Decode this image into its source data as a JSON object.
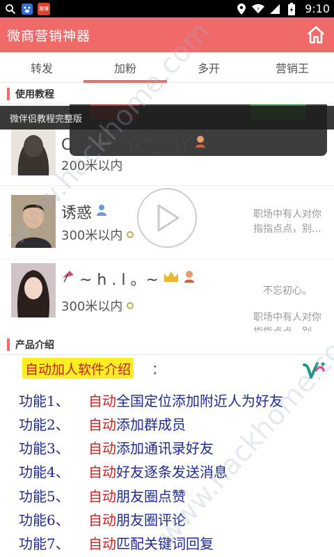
{
  "status_bar": {
    "time": "9:10",
    "app_badge": "赛博",
    "icons": [
      "search-icon",
      "baidu-icon",
      "app-badge-icon",
      "location-icon",
      "wifi-icon",
      "signal-icon",
      "battery-icon"
    ]
  },
  "app_bar": {
    "title": "微商营销神器",
    "home_icon": "home-icon"
  },
  "tabs": [
    {
      "label": "转发",
      "active": false
    },
    {
      "label": "加粉",
      "active": true
    },
    {
      "label": "多开",
      "active": false
    },
    {
      "label": "营销王",
      "active": false
    }
  ],
  "tutorial": {
    "section_label": "使用教程",
    "overlay_title": "微伴侣教程完整版",
    "contacts": [
      {
        "name": "C - - M　Y(^_^)Y",
        "distance": "200米以内",
        "message": ""
      },
      {
        "name": "诱惑",
        "distance": "300米以内",
        "message": "职场中有人对你指指点点，别..."
      },
      {
        "name": "~ h . l 。~",
        "distance": "300米以内",
        "message": "不忘初心。"
      }
    ]
  },
  "product": {
    "section_label": "产品介绍",
    "title": "自动加人软件介绍",
    "title_colon": "：",
    "features": [
      {
        "label": "功能1、",
        "auto": "自动",
        "text": "全国定位添加附近人为好友"
      },
      {
        "label": "功能2、",
        "auto": "自动",
        "text": "添加群成员"
      },
      {
        "label": "功能3、",
        "auto": "自动",
        "text": "添加通讯录好友"
      },
      {
        "label": "功能4、",
        "auto": "自动",
        "text": "好友逐条发送消息"
      },
      {
        "label": "功能5、",
        "auto": "自动",
        "text": "朋友圈点赞"
      },
      {
        "label": "功能6、",
        "auto": "自动",
        "text": "朋友圈评论"
      },
      {
        "label": "功能7、",
        "auto": "自动",
        "text": "匹配关键词回复"
      }
    ]
  },
  "watermark": "www.hackhome.com",
  "colors": {
    "accent": "#f06a6a",
    "feature_blue": "#1e2a9c",
    "feature_red": "#d42020",
    "highlight": "#ffee22"
  }
}
